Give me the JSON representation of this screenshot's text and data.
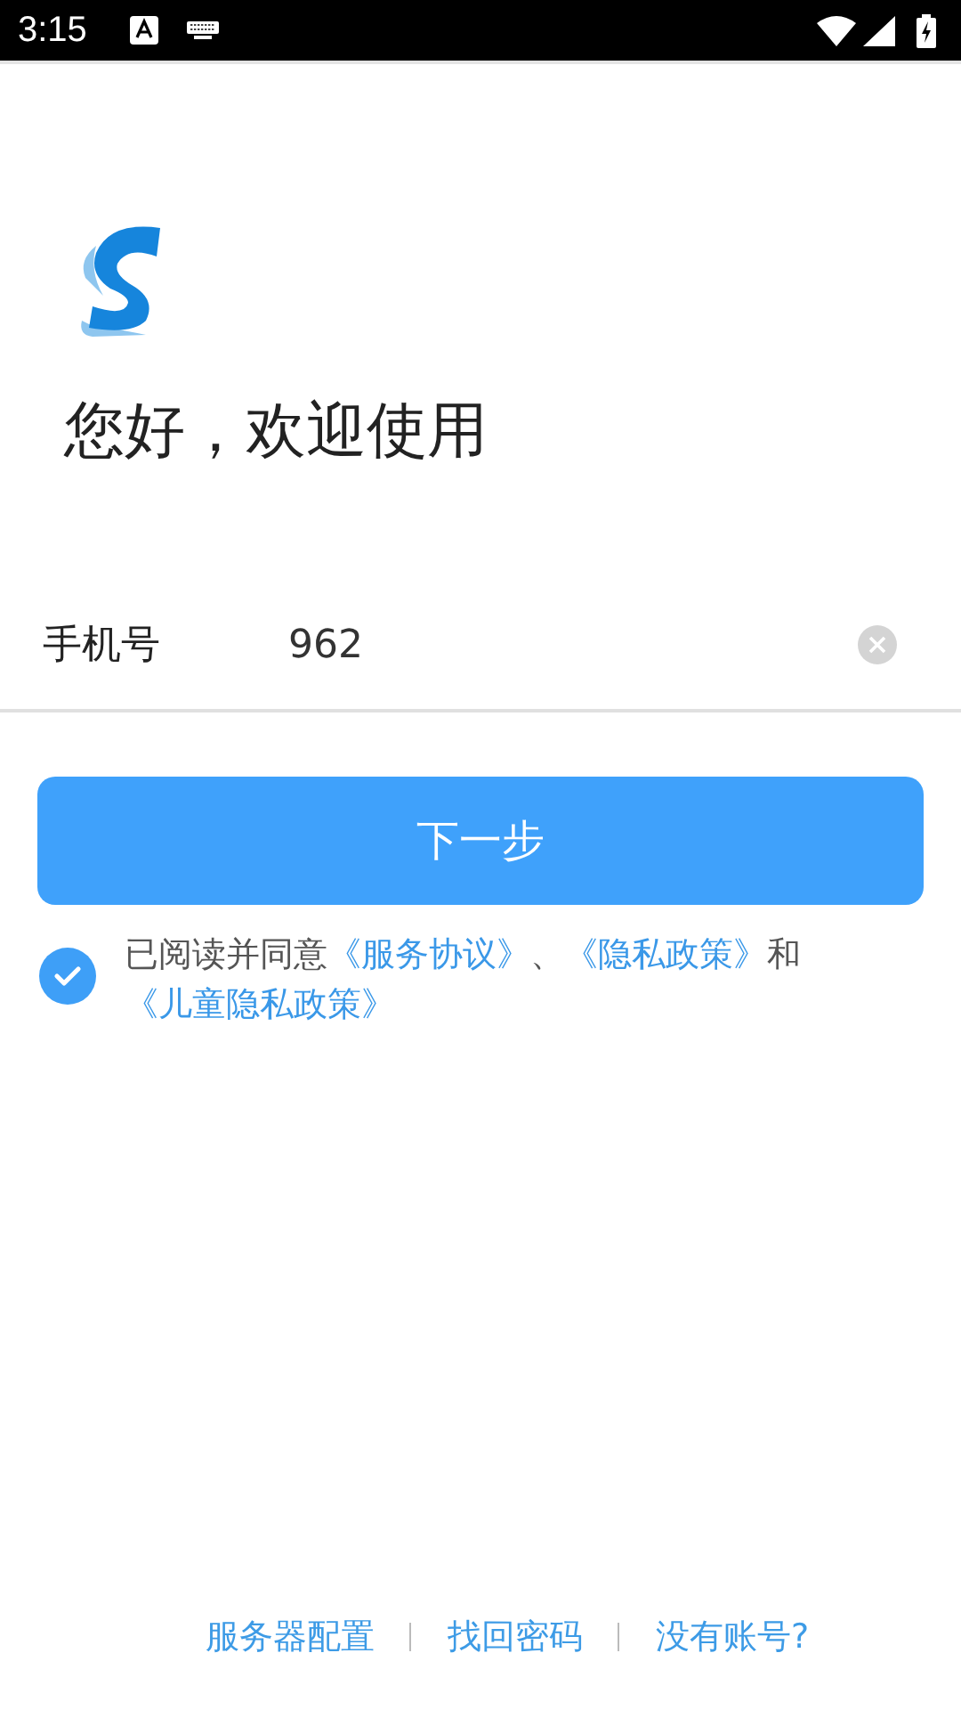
{
  "status_bar": {
    "time": "3:15"
  },
  "greeting": "您好，欢迎使用",
  "phone_field": {
    "label": "手机号",
    "value": "962"
  },
  "next_button": {
    "label": "下一步"
  },
  "agreement": {
    "checked": true,
    "parts": [
      {
        "kind": "text",
        "text": "已阅读并同意"
      },
      {
        "kind": "link",
        "text": "《服务协议》"
      },
      {
        "kind": "text",
        "text": "、"
      },
      {
        "kind": "link",
        "text": "《隐私政策》"
      },
      {
        "kind": "text",
        "text": "和"
      },
      {
        "kind": "link",
        "text": "《儿童隐私政策》"
      }
    ]
  },
  "footer_links": [
    "服务器配置",
    "找回密码",
    "没有账号?"
  ]
}
